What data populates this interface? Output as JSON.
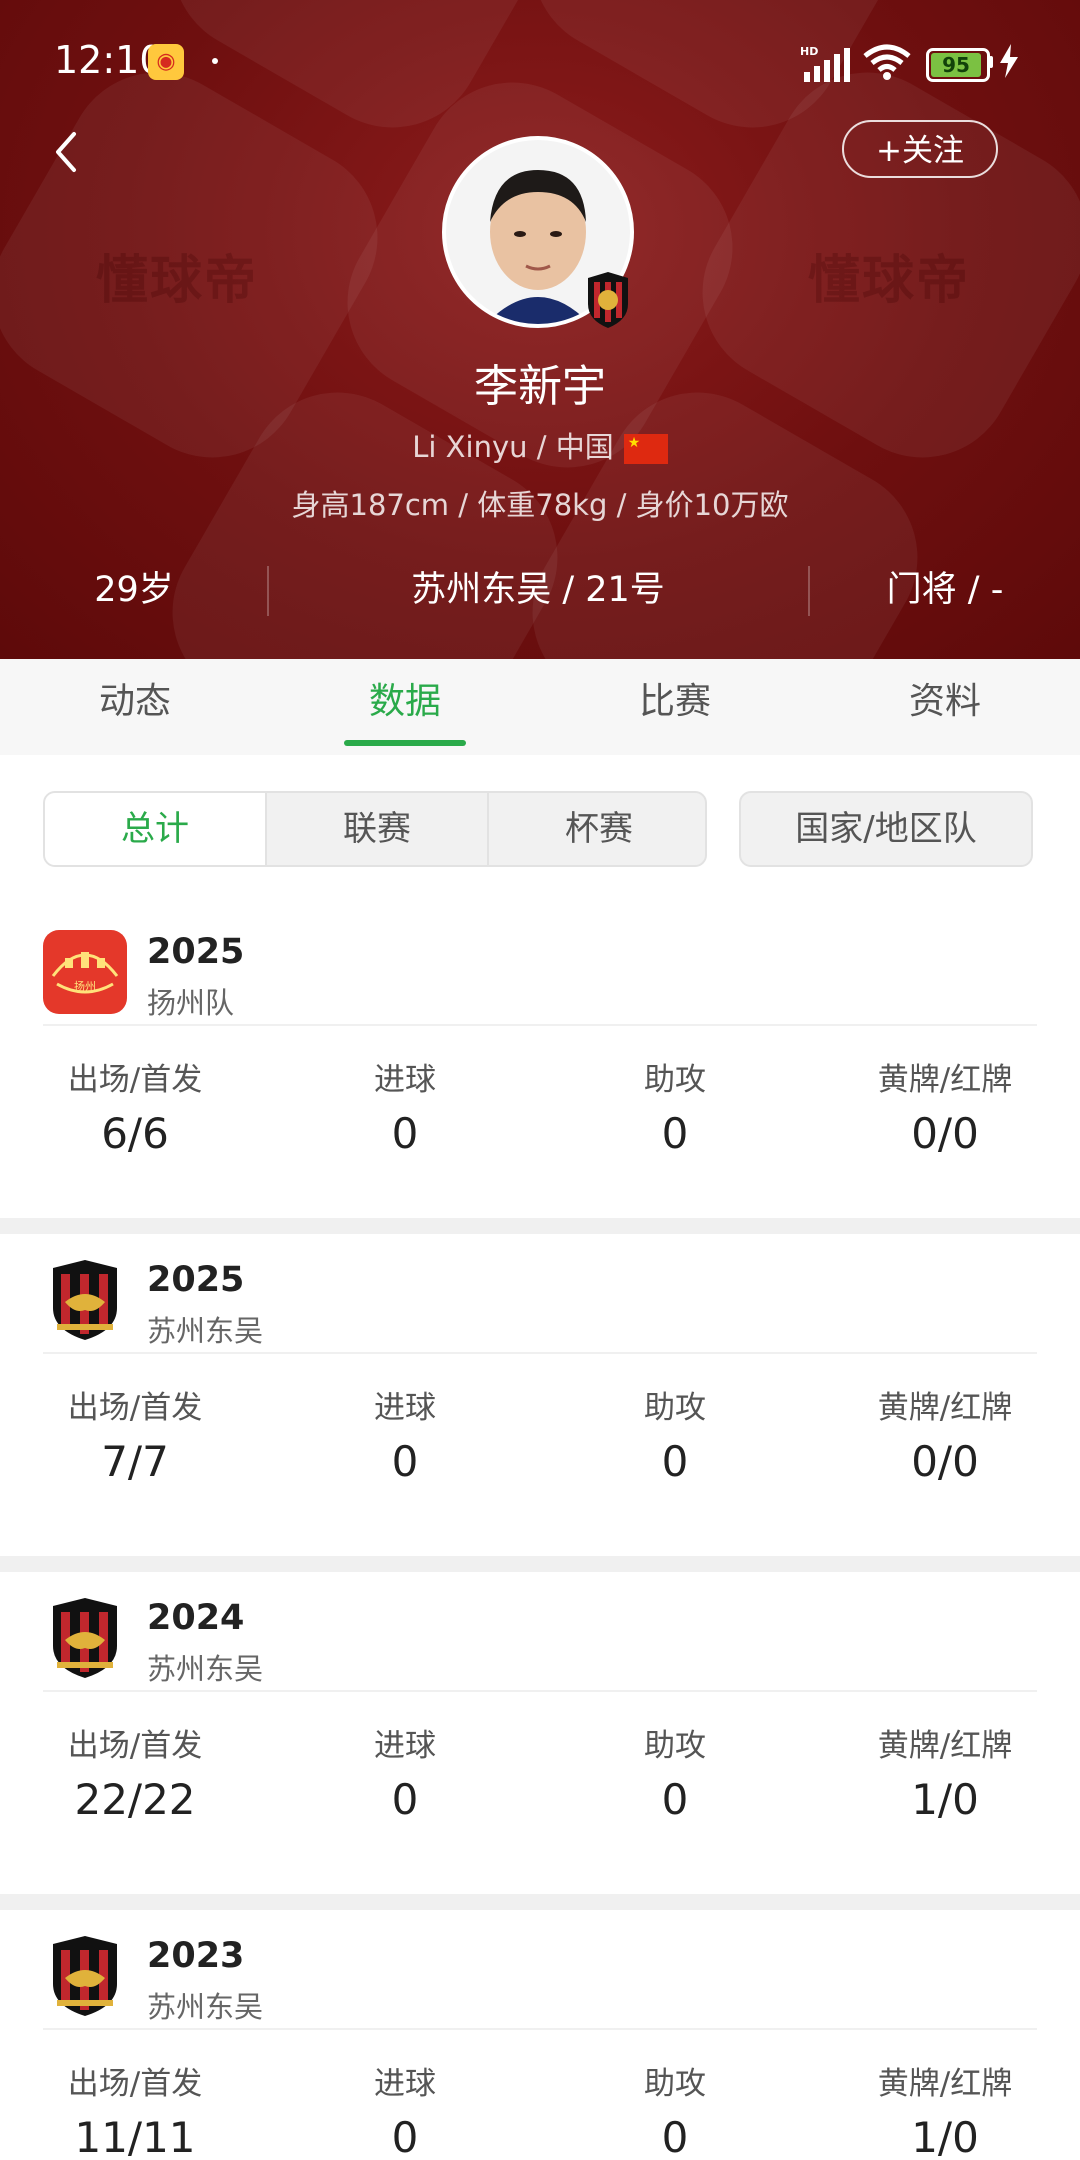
{
  "status_bar": {
    "time": "12:10",
    "battery": "95"
  },
  "header": {
    "follow_label": "+关注",
    "watermark": "懂球帝",
    "player_name": "李新宇",
    "player_sub": "Li Xinyu / 中国",
    "player_body": "身高187cm / 体重78kg / 身价10万欧",
    "age": "29岁",
    "club_number": "苏州东吴 / 21号",
    "position": "门将 / -"
  },
  "tabs": [
    {
      "label": "动态"
    },
    {
      "label": "数据"
    },
    {
      "label": "比赛"
    },
    {
      "label": "资料"
    }
  ],
  "filters": {
    "segments": [
      {
        "label": "总计"
      },
      {
        "label": "联赛"
      },
      {
        "label": "杯赛"
      }
    ],
    "national": "国家/地区队"
  },
  "stat_labels": {
    "apps": "出场/首发",
    "goals": "进球",
    "assists": "助攻",
    "cards": "黄牌/红牌"
  },
  "seasons": [
    {
      "year": "2025",
      "team": "扬州队",
      "apps": "6/6",
      "goals": "0",
      "assists": "0",
      "cards": "0/0"
    },
    {
      "year": "2025",
      "team": "苏州东吴",
      "apps": "7/7",
      "goals": "0",
      "assists": "0",
      "cards": "0/0"
    },
    {
      "year": "2024",
      "team": "苏州东吴",
      "apps": "22/22",
      "goals": "0",
      "assists": "0",
      "cards": "1/0"
    },
    {
      "year": "2023",
      "team": "苏州东吴",
      "apps": "11/11",
      "goals": "0",
      "assists": "0",
      "cards": "1/0"
    }
  ],
  "colors": {
    "header_bg": "#6e0f0f",
    "accent_green": "#2aaa4a"
  }
}
